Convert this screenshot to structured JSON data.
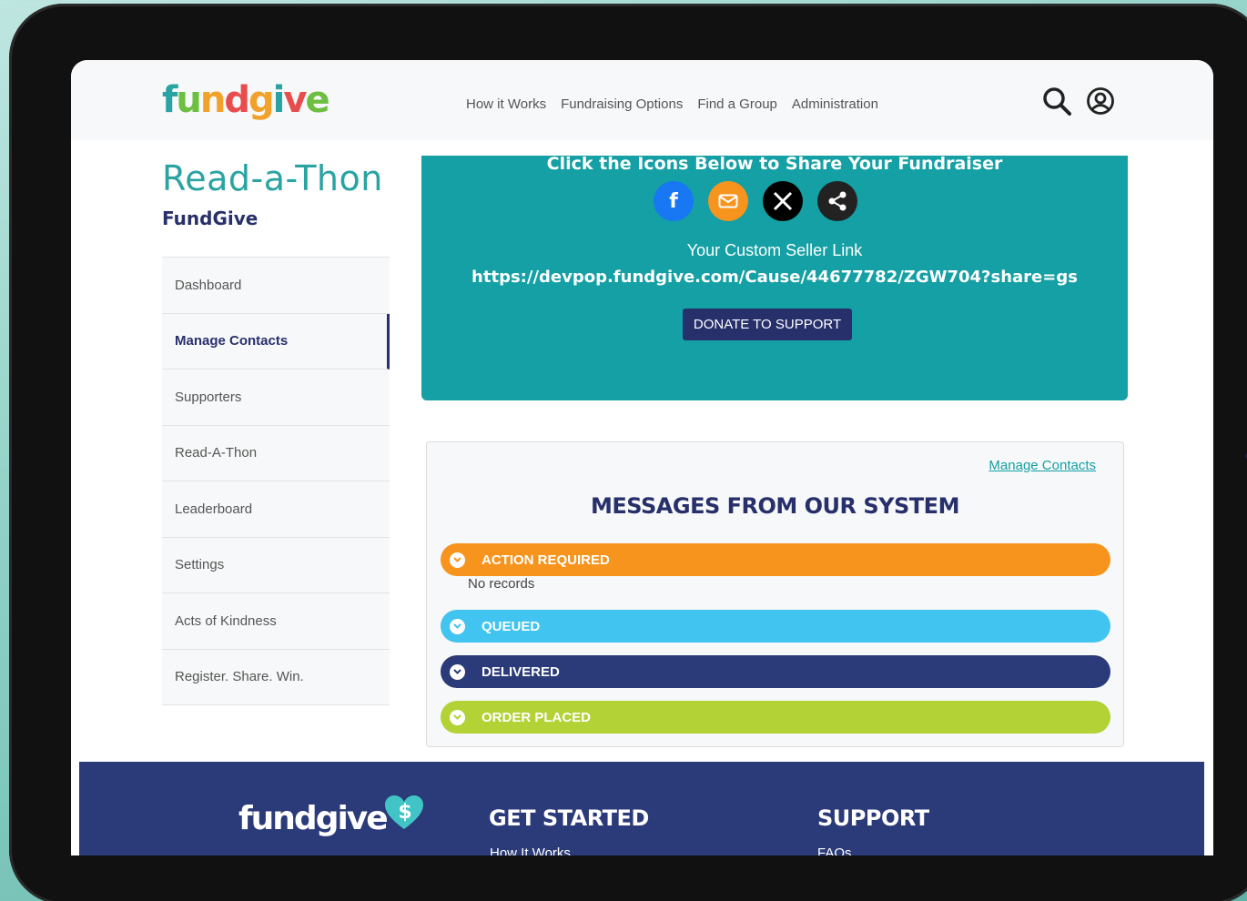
{
  "header": {
    "logo_letters": [
      "f",
      "u",
      "n",
      "d",
      "g",
      "i",
      "v",
      "e"
    ],
    "logo_colors": [
      "#2aa3a3",
      "#6cbf3f",
      "#f2a12a",
      "#e84d4d",
      "#f2a12a",
      "#2aa3a3",
      "#e84d4d",
      "#6cbf3f"
    ],
    "nav": [
      "How it Works",
      "Fundraising Options",
      "Find a Group",
      "Administration"
    ]
  },
  "sidebar": {
    "title": "Read-a-Thon",
    "org": "FundGive",
    "items": [
      {
        "label": "Dashboard",
        "active": false
      },
      {
        "label": "Manage Contacts",
        "active": true
      },
      {
        "label": "Supporters",
        "active": false
      },
      {
        "label": "Read-A-Thon",
        "active": false
      },
      {
        "label": "Leaderboard",
        "active": false
      },
      {
        "label": "Settings",
        "active": false
      },
      {
        "label": "Acts of Kindness",
        "active": false
      },
      {
        "label": "Register. Share. Win.",
        "active": false
      }
    ]
  },
  "share": {
    "heading": "Click the Icons Below to Share Your Fundraiser",
    "icons": [
      {
        "name": "facebook-icon",
        "glyph": "f",
        "color": "#1877f2"
      },
      {
        "name": "email-icon",
        "glyph": "✉",
        "color": "#f7941d"
      },
      {
        "name": "x-icon",
        "glyph": "𝕏",
        "color": "#000000"
      },
      {
        "name": "share-icon",
        "glyph": "⋖",
        "color": "#222222"
      }
    ],
    "seller_label": "Your Custom Seller Link",
    "seller_link": "https://devpop.fundgive.com/Cause/44677782/ZGW704?share=gs",
    "donate_label": "DONATE TO SUPPORT"
  },
  "messages": {
    "manage_link": "Manage Contacts",
    "heading": "MESSAGES FROM OUR SYSTEM",
    "no_records": "No records",
    "bars": [
      {
        "label": "ACTION REQUIRED",
        "color": "#f7941d"
      },
      {
        "label": "QUEUED",
        "color": "#41c4ef"
      },
      {
        "label": "DELIVERED",
        "color": "#2b3a78"
      },
      {
        "label": "ORDER PLACED",
        "color": "#b2d235"
      }
    ]
  },
  "footer": {
    "logo_text": "fundgive",
    "get_started": "GET STARTED",
    "get_started_link": "How It Works",
    "support": "SUPPORT",
    "support_link": "FAQs"
  }
}
